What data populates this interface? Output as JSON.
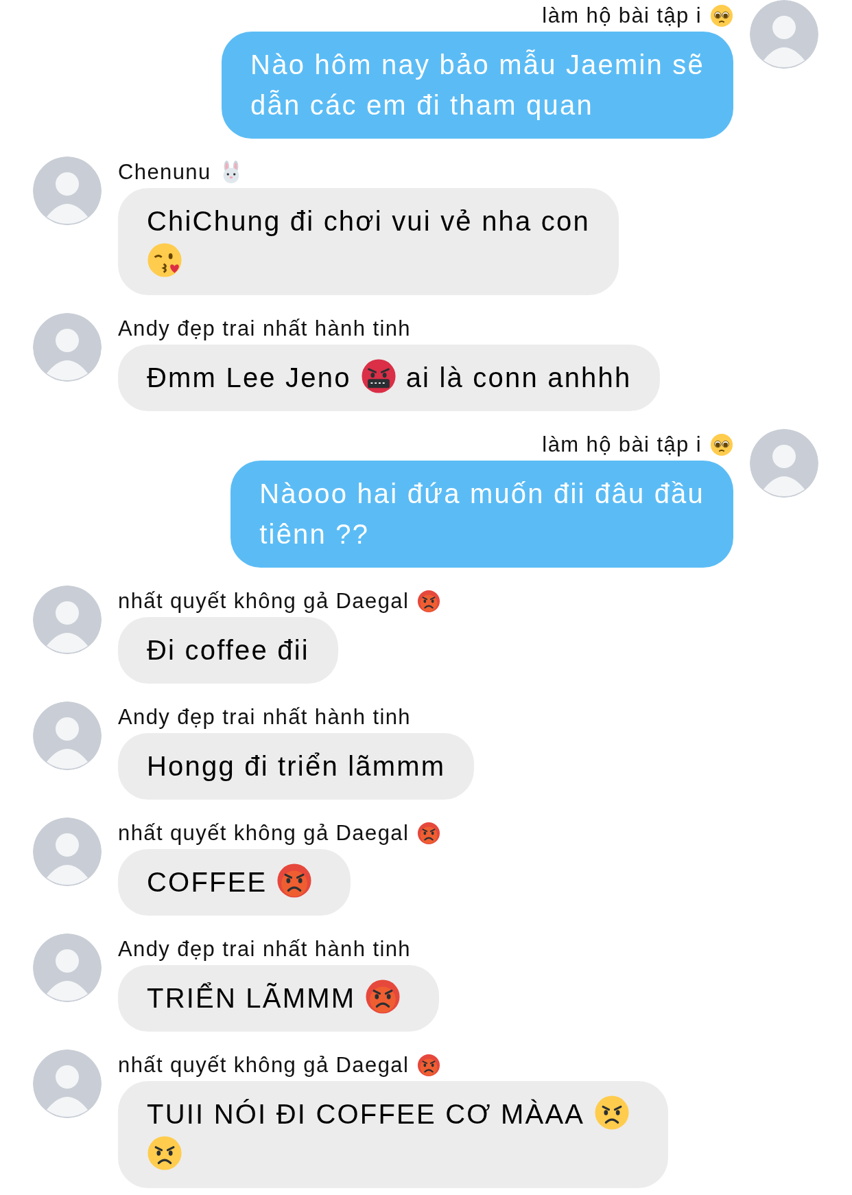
{
  "messages": [
    {
      "kind": "outgoing",
      "sender": [
        {
          "kind": "text",
          "text": "làm hộ bài tập i"
        },
        {
          "kind": "pleading"
        }
      ],
      "lines": [
        [
          {
            "kind": "text",
            "text": "Nào hôm nay bảo mẫu Jaemin sẽ"
          }
        ],
        [
          {
            "kind": "text",
            "text": "dẫn các em đi tham quan"
          }
        ]
      ]
    },
    {
      "kind": "incoming",
      "sender": [
        {
          "kind": "text",
          "text": "Chenunu"
        },
        {
          "kind": "rabbit"
        }
      ],
      "lines": [
        [
          {
            "kind": "text",
            "text": "ChiChung đi chơi vui vẻ nha con"
          }
        ],
        [
          {
            "kind": "kissing"
          }
        ]
      ]
    },
    {
      "kind": "incoming",
      "sender": [
        {
          "kind": "text",
          "text": "Andy đẹp trai nhất hành tinh"
        }
      ],
      "lines": [
        [
          {
            "kind": "text",
            "text": "Đmm Lee Jeno"
          },
          {
            "kind": "cursing"
          },
          {
            "kind": "text",
            "text": "ai là conn anhhh"
          }
        ]
      ]
    },
    {
      "kind": "outgoing",
      "sender": [
        {
          "kind": "text",
          "text": "làm hộ bài tập i"
        },
        {
          "kind": "pleading"
        }
      ],
      "lines": [
        [
          {
            "kind": "text",
            "text": "Nàooo hai đứa muốn đii đâu đầu"
          }
        ],
        [
          {
            "kind": "text",
            "text": "tiênn ??"
          }
        ]
      ]
    },
    {
      "kind": "incoming",
      "sender": [
        {
          "kind": "text",
          "text": "nhất quyết không gả Daegal"
        },
        {
          "kind": "pouting"
        }
      ],
      "lines": [
        [
          {
            "kind": "text",
            "text": "Đi coffee đii"
          }
        ]
      ]
    },
    {
      "kind": "incoming",
      "sender": [
        {
          "kind": "text",
          "text": "Andy đẹp trai nhất hành tinh"
        }
      ],
      "lines": [
        [
          {
            "kind": "text",
            "text": "Hongg đi triển lãmmm"
          }
        ]
      ]
    },
    {
      "kind": "incoming",
      "sender": [
        {
          "kind": "text",
          "text": "nhất quyết không gả Daegal"
        },
        {
          "kind": "pouting"
        }
      ],
      "lines": [
        [
          {
            "kind": "text",
            "text": "COFFEE"
          },
          {
            "kind": "pouting"
          }
        ]
      ]
    },
    {
      "kind": "incoming",
      "sender": [
        {
          "kind": "text",
          "text": "Andy đẹp trai nhất hành tinh"
        }
      ],
      "lines": [
        [
          {
            "kind": "text",
            "text": "TRIỂN LÃMMM"
          },
          {
            "kind": "pouting"
          }
        ]
      ]
    },
    {
      "kind": "incoming",
      "sender": [
        {
          "kind": "text",
          "text": "nhất quyết không gả Daegal"
        },
        {
          "kind": "pouting"
        }
      ],
      "lines": [
        [
          {
            "kind": "text",
            "text": "TUII NÓI ĐI COFFEE CƠ MÀAA"
          },
          {
            "kind": "angry"
          }
        ],
        [
          {
            "kind": "angry"
          }
        ]
      ]
    }
  ]
}
